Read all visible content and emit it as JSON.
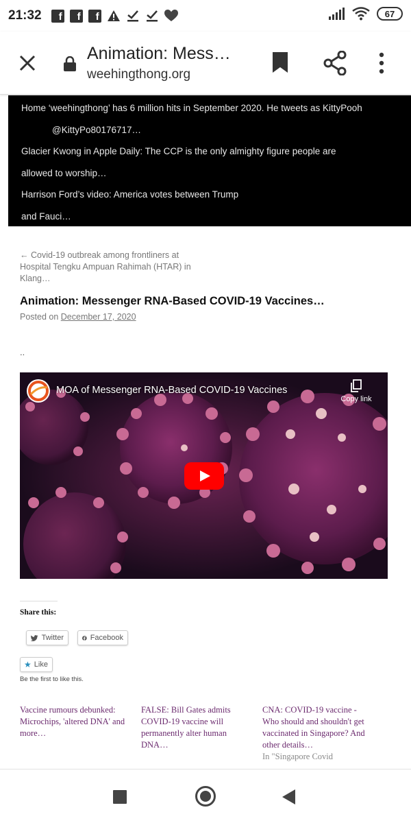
{
  "status_bar": {
    "time": "21:32",
    "battery": "67",
    "notification_icons": [
      "facebook-icon",
      "facebook-icon",
      "facebook-icon",
      "warning-icon",
      "check-icon",
      "check-icon",
      "heart-icon"
    ]
  },
  "browser": {
    "title": "Animation: Mess…",
    "domain": "weehingthong.org"
  },
  "ticker": {
    "lines": [
      "Home   ‘weehingthong’ has 6 million hits in September 2020. He tweets as KittyPooh",
      "@KittyPo80176717…",
      "Glacier Kwong in Apple Daily: The CCP is the only almighty figure people are",
      "allowed to worship…",
      "Harrison Ford’s video: America votes between Trump",
      "and Fauci…"
    ]
  },
  "article": {
    "prev_link": "← Covid-19 outbreak among frontliners at Hospital Tengku Ampuan Rahimah (HTAR) in Klang…",
    "title": "Animation: Messenger RNA-Based COVID-19 Vaccines…",
    "posted_label": "Posted on ",
    "posted_date": "December 17, 2020",
    "body_dots": ".."
  },
  "video": {
    "title": "MOA of Messenger RNA-Based COVID-19 Vaccines",
    "copy_link": "Copy link"
  },
  "share": {
    "heading": "Share this:",
    "twitter": "Twitter",
    "facebook": "Facebook",
    "like": "Like",
    "like_note": "Be the first to like this."
  },
  "related": [
    {
      "title": "Vaccine rumours debunked: Microchips, 'altered DNA' and more…"
    },
    {
      "title": "FALSE: Bill Gates admits COVID-19 vaccine will permanently alter human DNA…"
    },
    {
      "title": "CNA: COVID-19 vaccine - Who should and shouldn't get vaccinated in Singapore? And other details…",
      "context": "In \"Singapore Covid"
    }
  ],
  "colors": {
    "ticker_bg": "#000000",
    "link_purple": "#6b2a6e",
    "youtube_red": "#ff0000"
  }
}
